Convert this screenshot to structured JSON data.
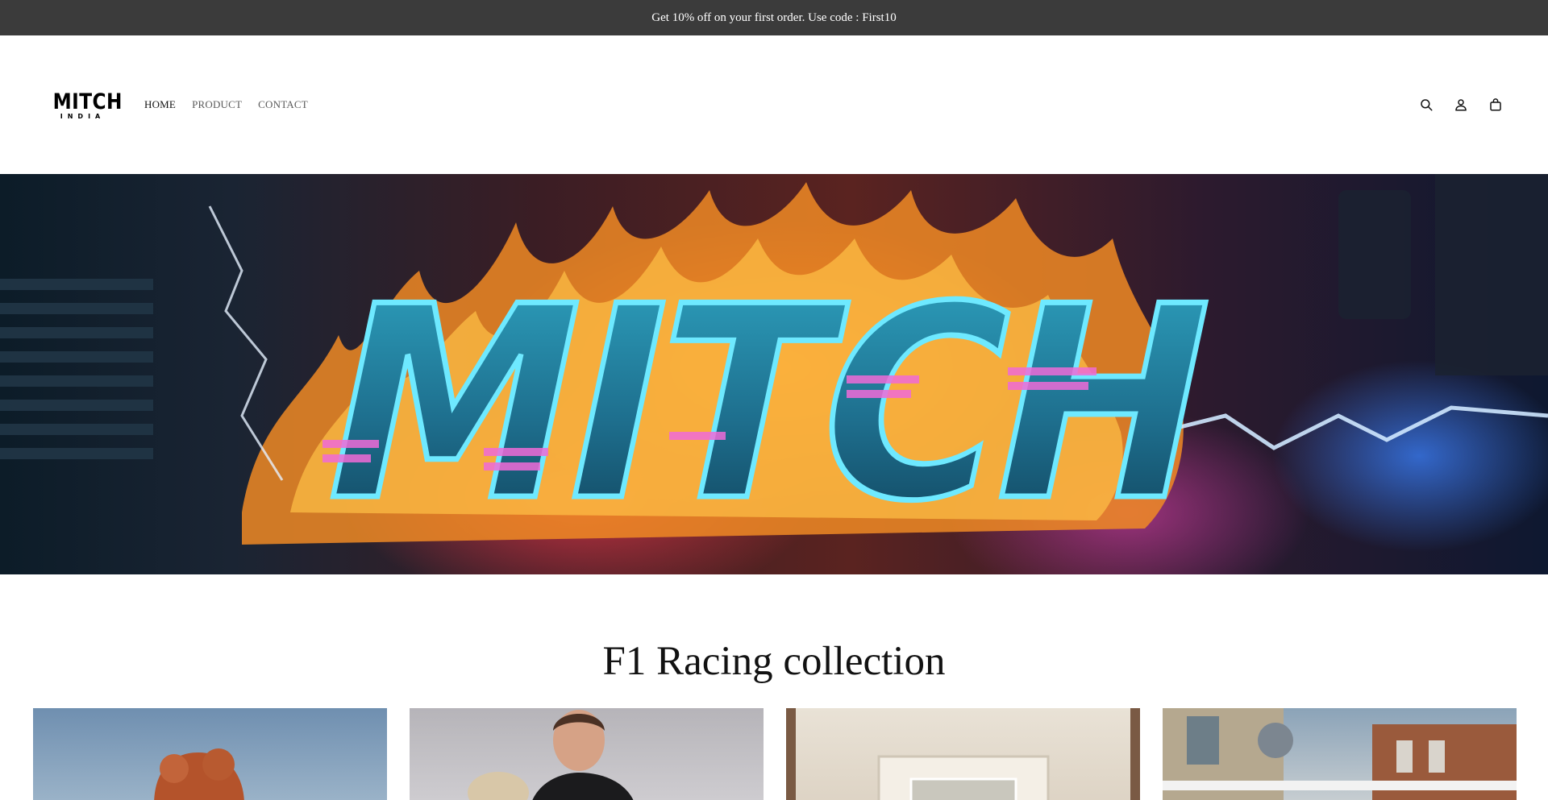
{
  "announcement": {
    "text": "Get 10% off on your first order. Use code : First10"
  },
  "header": {
    "logo": {
      "main": "MITCH",
      "sub": "INDIA"
    },
    "nav": [
      {
        "label": "HOME",
        "active": true
      },
      {
        "label": "PRODUCT",
        "active": false
      },
      {
        "label": "CONTACT",
        "active": false
      }
    ],
    "icons": [
      "search-icon",
      "account-icon",
      "cart-icon"
    ]
  },
  "hero": {
    "graffiti_text": "MITCH"
  },
  "collection": {
    "title": "F1 Racing collection",
    "products": [
      "product-image-1",
      "product-image-2",
      "product-image-3",
      "product-image-4"
    ]
  },
  "colors": {
    "announcement_bg": "#3b3b3b",
    "announcement_text": "#ffffff",
    "page_bg": "#ffffff",
    "text": "#121212",
    "nav_inactive": "#5a5a5a"
  }
}
